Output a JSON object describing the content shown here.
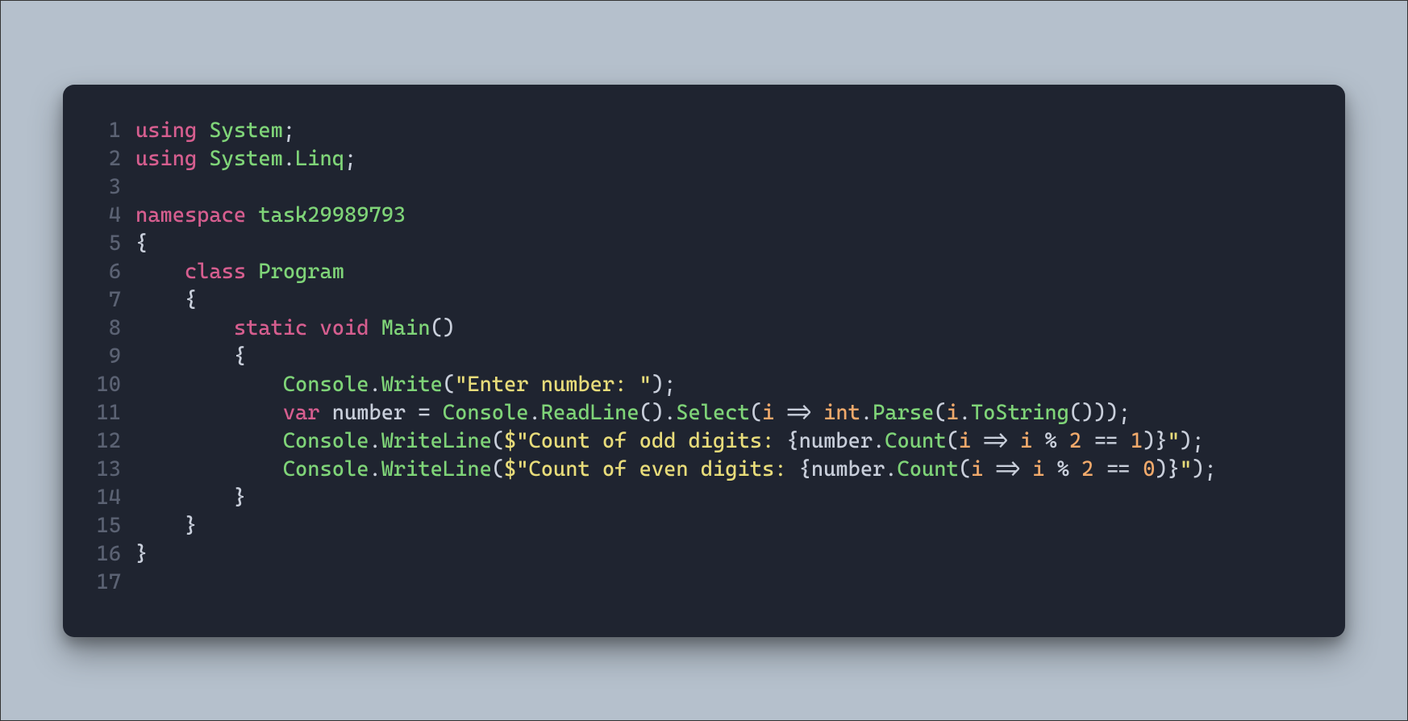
{
  "code": {
    "lines": [
      {
        "num": "1",
        "tokens": [
          {
            "t": "using",
            "c": "keyword"
          },
          {
            "t": " "
          },
          {
            "t": "System",
            "c": "type"
          },
          {
            "t": ";",
            "c": "punct"
          }
        ]
      },
      {
        "num": "2",
        "tokens": [
          {
            "t": "using",
            "c": "keyword"
          },
          {
            "t": " "
          },
          {
            "t": "System",
            "c": "type"
          },
          {
            "t": ".",
            "c": "punct"
          },
          {
            "t": "Linq",
            "c": "type"
          },
          {
            "t": ";",
            "c": "punct"
          }
        ]
      },
      {
        "num": "3",
        "tokens": []
      },
      {
        "num": "4",
        "tokens": [
          {
            "t": "namespace",
            "c": "keyword"
          },
          {
            "t": " "
          },
          {
            "t": "task29989793",
            "c": "type"
          }
        ]
      },
      {
        "num": "5",
        "tokens": [
          {
            "t": "{",
            "c": "punct"
          }
        ]
      },
      {
        "num": "6",
        "tokens": [
          {
            "t": "    "
          },
          {
            "t": "class",
            "c": "keyword"
          },
          {
            "t": " "
          },
          {
            "t": "Program",
            "c": "type"
          }
        ]
      },
      {
        "num": "7",
        "tokens": [
          {
            "t": "    "
          },
          {
            "t": "{",
            "c": "punct"
          }
        ]
      },
      {
        "num": "8",
        "tokens": [
          {
            "t": "        "
          },
          {
            "t": "static",
            "c": "keyword"
          },
          {
            "t": " "
          },
          {
            "t": "void",
            "c": "keyword"
          },
          {
            "t": " "
          },
          {
            "t": "Main",
            "c": "method"
          },
          {
            "t": "()",
            "c": "punct"
          }
        ]
      },
      {
        "num": "9",
        "tokens": [
          {
            "t": "        "
          },
          {
            "t": "{",
            "c": "punct"
          }
        ]
      },
      {
        "num": "10",
        "tokens": [
          {
            "t": "            "
          },
          {
            "t": "Console",
            "c": "type"
          },
          {
            "t": ".",
            "c": "punct"
          },
          {
            "t": "Write",
            "c": "method"
          },
          {
            "t": "(",
            "c": "punct"
          },
          {
            "t": "\"Enter number: \"",
            "c": "string"
          },
          {
            "t": ");",
            "c": "punct"
          }
        ]
      },
      {
        "num": "11",
        "tokens": [
          {
            "t": "            "
          },
          {
            "t": "var",
            "c": "keyword"
          },
          {
            "t": " "
          },
          {
            "t": "number",
            "c": "punct"
          },
          {
            "t": " = ",
            "c": "punct"
          },
          {
            "t": "Console",
            "c": "type"
          },
          {
            "t": ".",
            "c": "punct"
          },
          {
            "t": "ReadLine",
            "c": "method"
          },
          {
            "t": "().",
            "c": "punct"
          },
          {
            "t": "Select",
            "c": "method"
          },
          {
            "t": "(",
            "c": "punct"
          },
          {
            "t": "i",
            "c": "param"
          },
          {
            "t": " => ",
            "c": "punct"
          },
          {
            "t": "int",
            "c": "builtin"
          },
          {
            "t": ".",
            "c": "punct"
          },
          {
            "t": "Parse",
            "c": "method"
          },
          {
            "t": "(",
            "c": "punct"
          },
          {
            "t": "i",
            "c": "param"
          },
          {
            "t": ".",
            "c": "punct"
          },
          {
            "t": "ToString",
            "c": "method"
          },
          {
            "t": "()));",
            "c": "punct"
          }
        ]
      },
      {
        "num": "12",
        "tokens": [
          {
            "t": "            "
          },
          {
            "t": "Console",
            "c": "type"
          },
          {
            "t": ".",
            "c": "punct"
          },
          {
            "t": "WriteLine",
            "c": "method"
          },
          {
            "t": "(",
            "c": "punct"
          },
          {
            "t": "$\"Count of odd digits: ",
            "c": "string"
          },
          {
            "t": "{",
            "c": "punct"
          },
          {
            "t": "number",
            "c": "punct"
          },
          {
            "t": ".",
            "c": "punct"
          },
          {
            "t": "Count",
            "c": "method"
          },
          {
            "t": "(",
            "c": "punct"
          },
          {
            "t": "i",
            "c": "param"
          },
          {
            "t": " => ",
            "c": "punct"
          },
          {
            "t": "i",
            "c": "param"
          },
          {
            "t": " % ",
            "c": "punct"
          },
          {
            "t": "2",
            "c": "num"
          },
          {
            "t": " == ",
            "c": "punct"
          },
          {
            "t": "1",
            "c": "num"
          },
          {
            "t": ")",
            "c": "punct"
          },
          {
            "t": "}",
            "c": "punct"
          },
          {
            "t": "\"",
            "c": "string"
          },
          {
            "t": ");",
            "c": "punct"
          }
        ]
      },
      {
        "num": "13",
        "tokens": [
          {
            "t": "            "
          },
          {
            "t": "Console",
            "c": "type"
          },
          {
            "t": ".",
            "c": "punct"
          },
          {
            "t": "WriteLine",
            "c": "method"
          },
          {
            "t": "(",
            "c": "punct"
          },
          {
            "t": "$\"Count of even digits: ",
            "c": "string"
          },
          {
            "t": "{",
            "c": "punct"
          },
          {
            "t": "number",
            "c": "punct"
          },
          {
            "t": ".",
            "c": "punct"
          },
          {
            "t": "Count",
            "c": "method"
          },
          {
            "t": "(",
            "c": "punct"
          },
          {
            "t": "i",
            "c": "param"
          },
          {
            "t": " => ",
            "c": "punct"
          },
          {
            "t": "i",
            "c": "param"
          },
          {
            "t": " % ",
            "c": "punct"
          },
          {
            "t": "2",
            "c": "num"
          },
          {
            "t": " == ",
            "c": "punct"
          },
          {
            "t": "0",
            "c": "num"
          },
          {
            "t": ")",
            "c": "punct"
          },
          {
            "t": "}",
            "c": "punct"
          },
          {
            "t": "\"",
            "c": "string"
          },
          {
            "t": ");",
            "c": "punct"
          }
        ]
      },
      {
        "num": "14",
        "tokens": [
          {
            "t": "        "
          },
          {
            "t": "}",
            "c": "punct"
          }
        ]
      },
      {
        "num": "15",
        "tokens": [
          {
            "t": "    "
          },
          {
            "t": "}",
            "c": "punct"
          }
        ]
      },
      {
        "num": "16",
        "tokens": [
          {
            "t": "}",
            "c": "punct"
          }
        ]
      },
      {
        "num": "17",
        "tokens": []
      }
    ]
  }
}
